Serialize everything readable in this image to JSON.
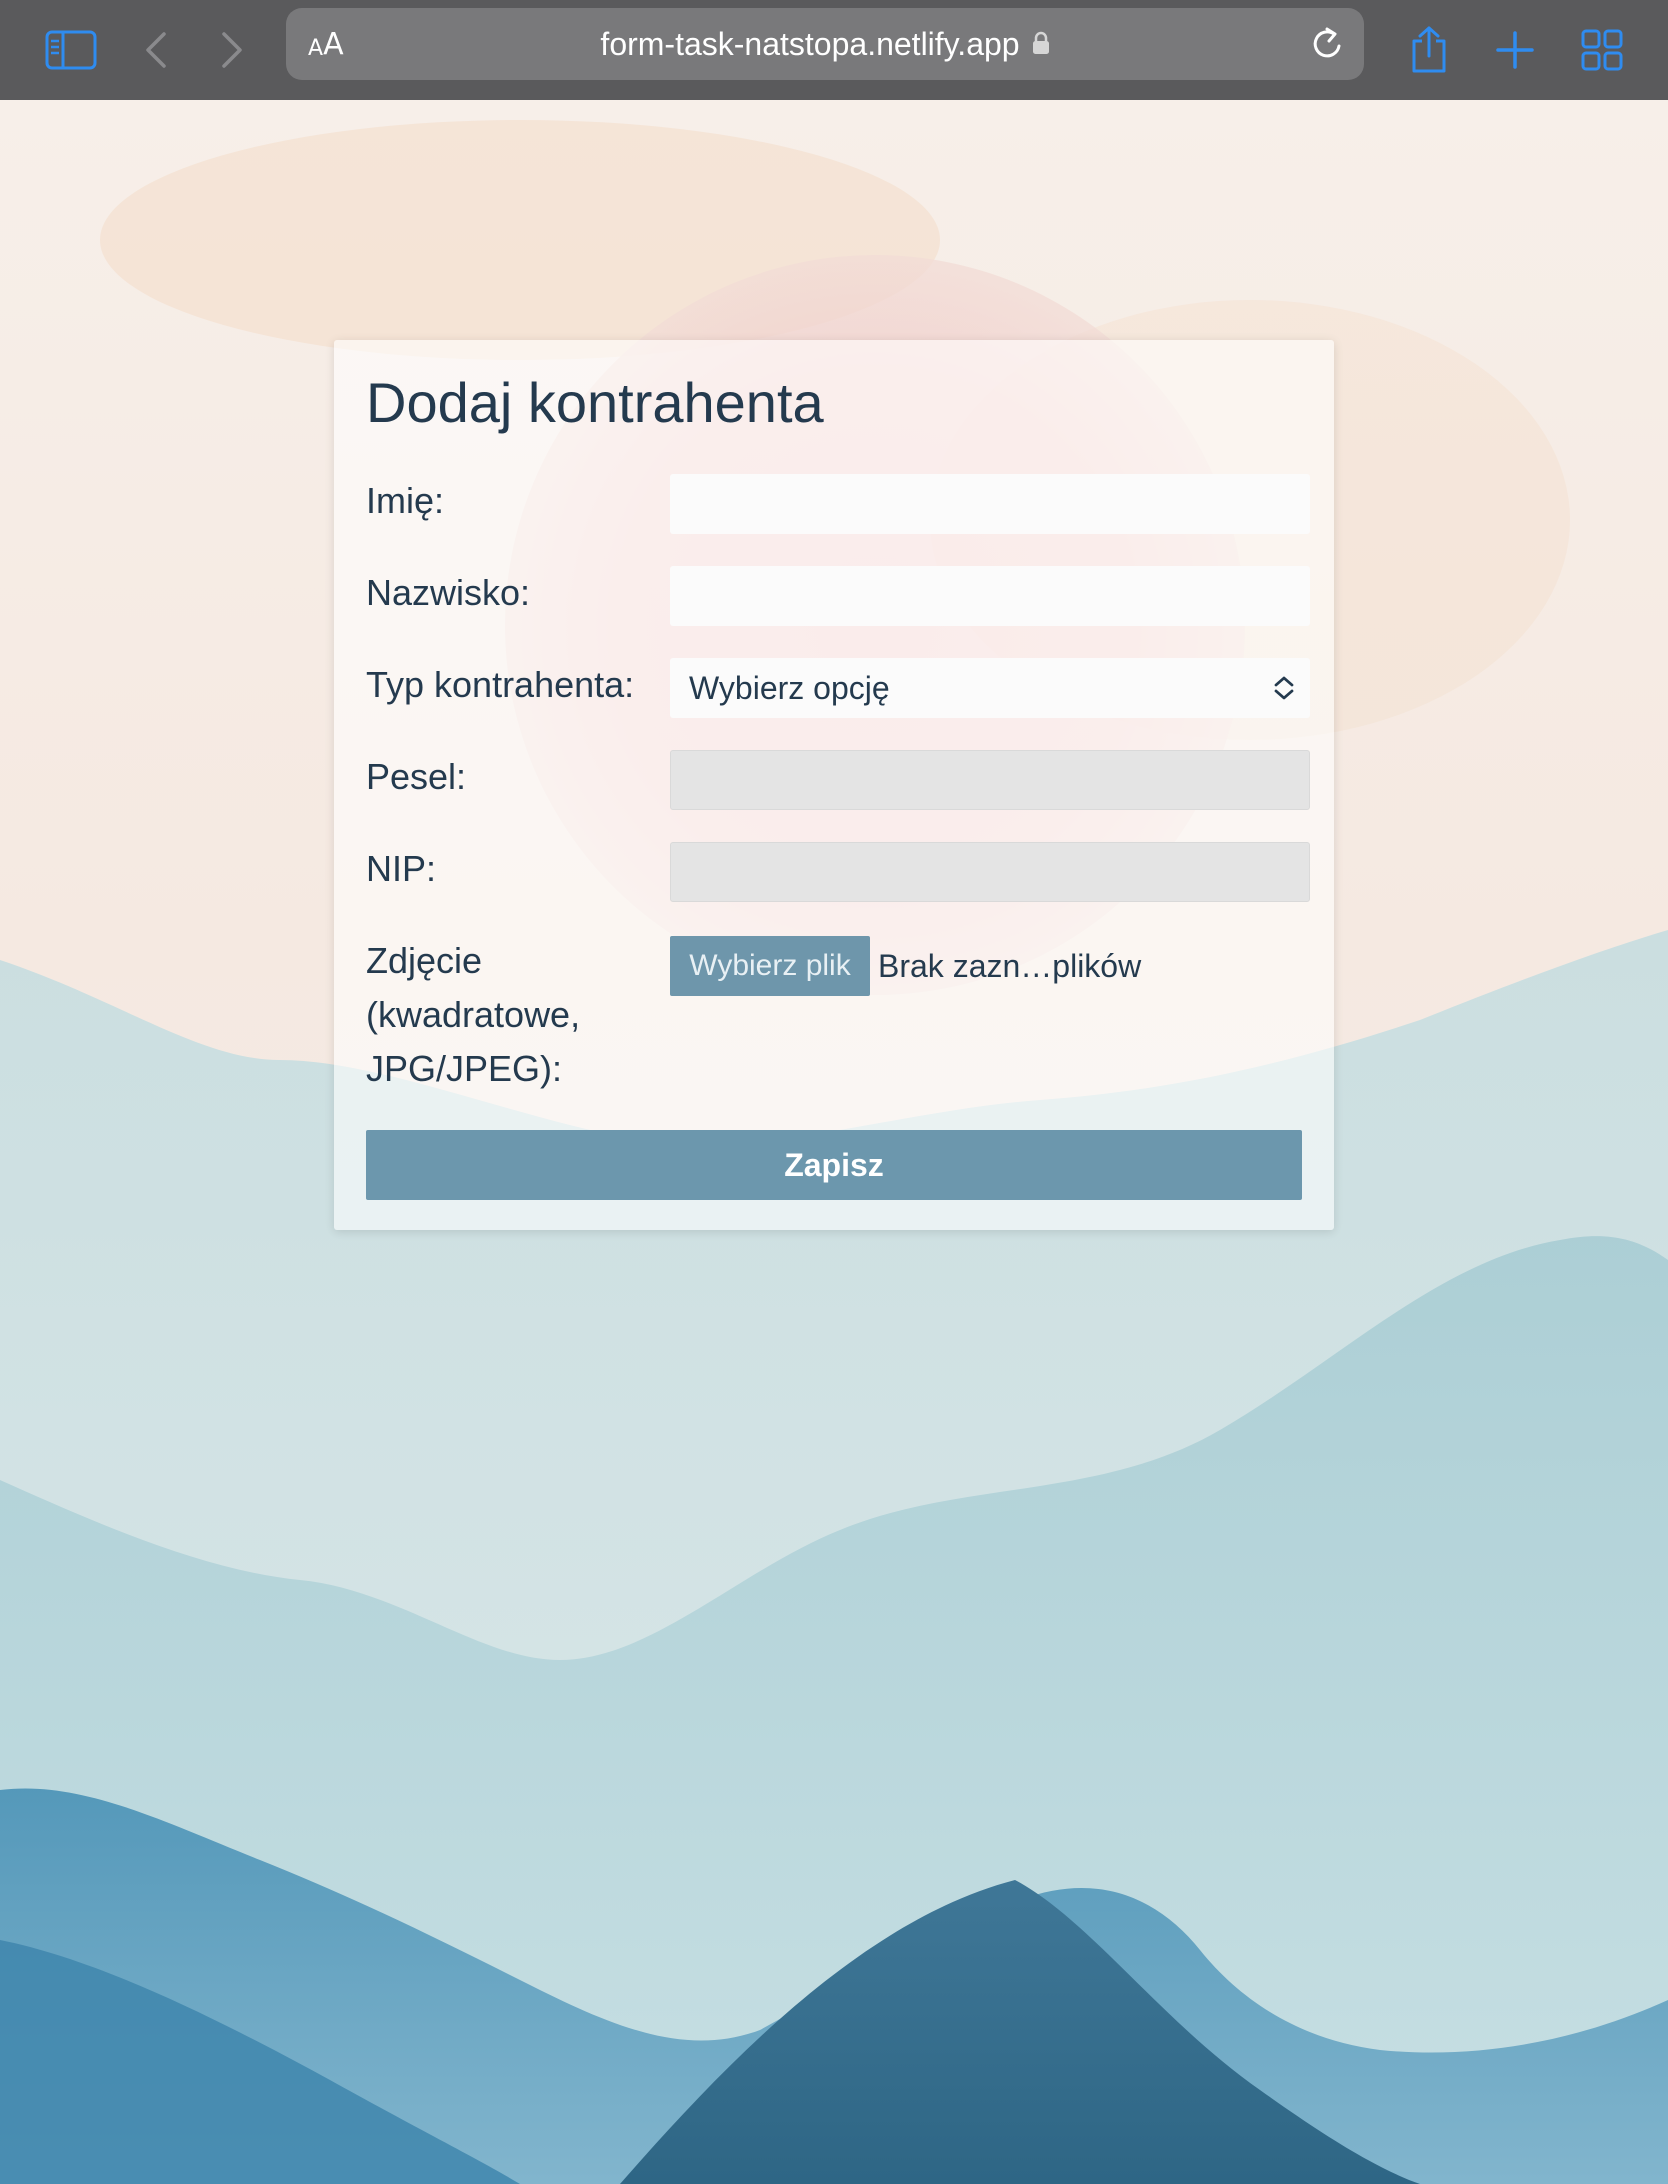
{
  "browser": {
    "text_size_label_small": "A",
    "text_size_label_big": "A",
    "url": "form-task-natstopa.netlify.app",
    "icons": [
      "sidebar-icon",
      "back-icon",
      "forward-icon",
      "lock-icon",
      "reload-icon",
      "share-icon",
      "new-tab-icon",
      "tab-overview-icon"
    ]
  },
  "form": {
    "title": "Dodaj kontrahenta",
    "first_name_label": "Imię:",
    "first_name_value": "",
    "last_name_label": "Nazwisko:",
    "last_name_value": "",
    "type_label": "Typ kontrahenta:",
    "type_selected": "Wybierz opcję",
    "pesel_label": "Pesel:",
    "pesel_value": "",
    "nip_label": "NIP:",
    "nip_value": "",
    "photo_label_line1": "Zdjęcie",
    "photo_label_line2": "(kwadratowe,",
    "photo_label_line3": "JPG/JPEG):",
    "file_button_label": "Wybierz plik",
    "file_status": "Brak zazn…plików",
    "submit_label": "Zapisz"
  },
  "colors": {
    "toolbar": "#5a5a5c",
    "address_bar": "#79797b",
    "accent_blue": "#2f8cf0",
    "button": "#6c97ad",
    "text": "#243a4e"
  }
}
